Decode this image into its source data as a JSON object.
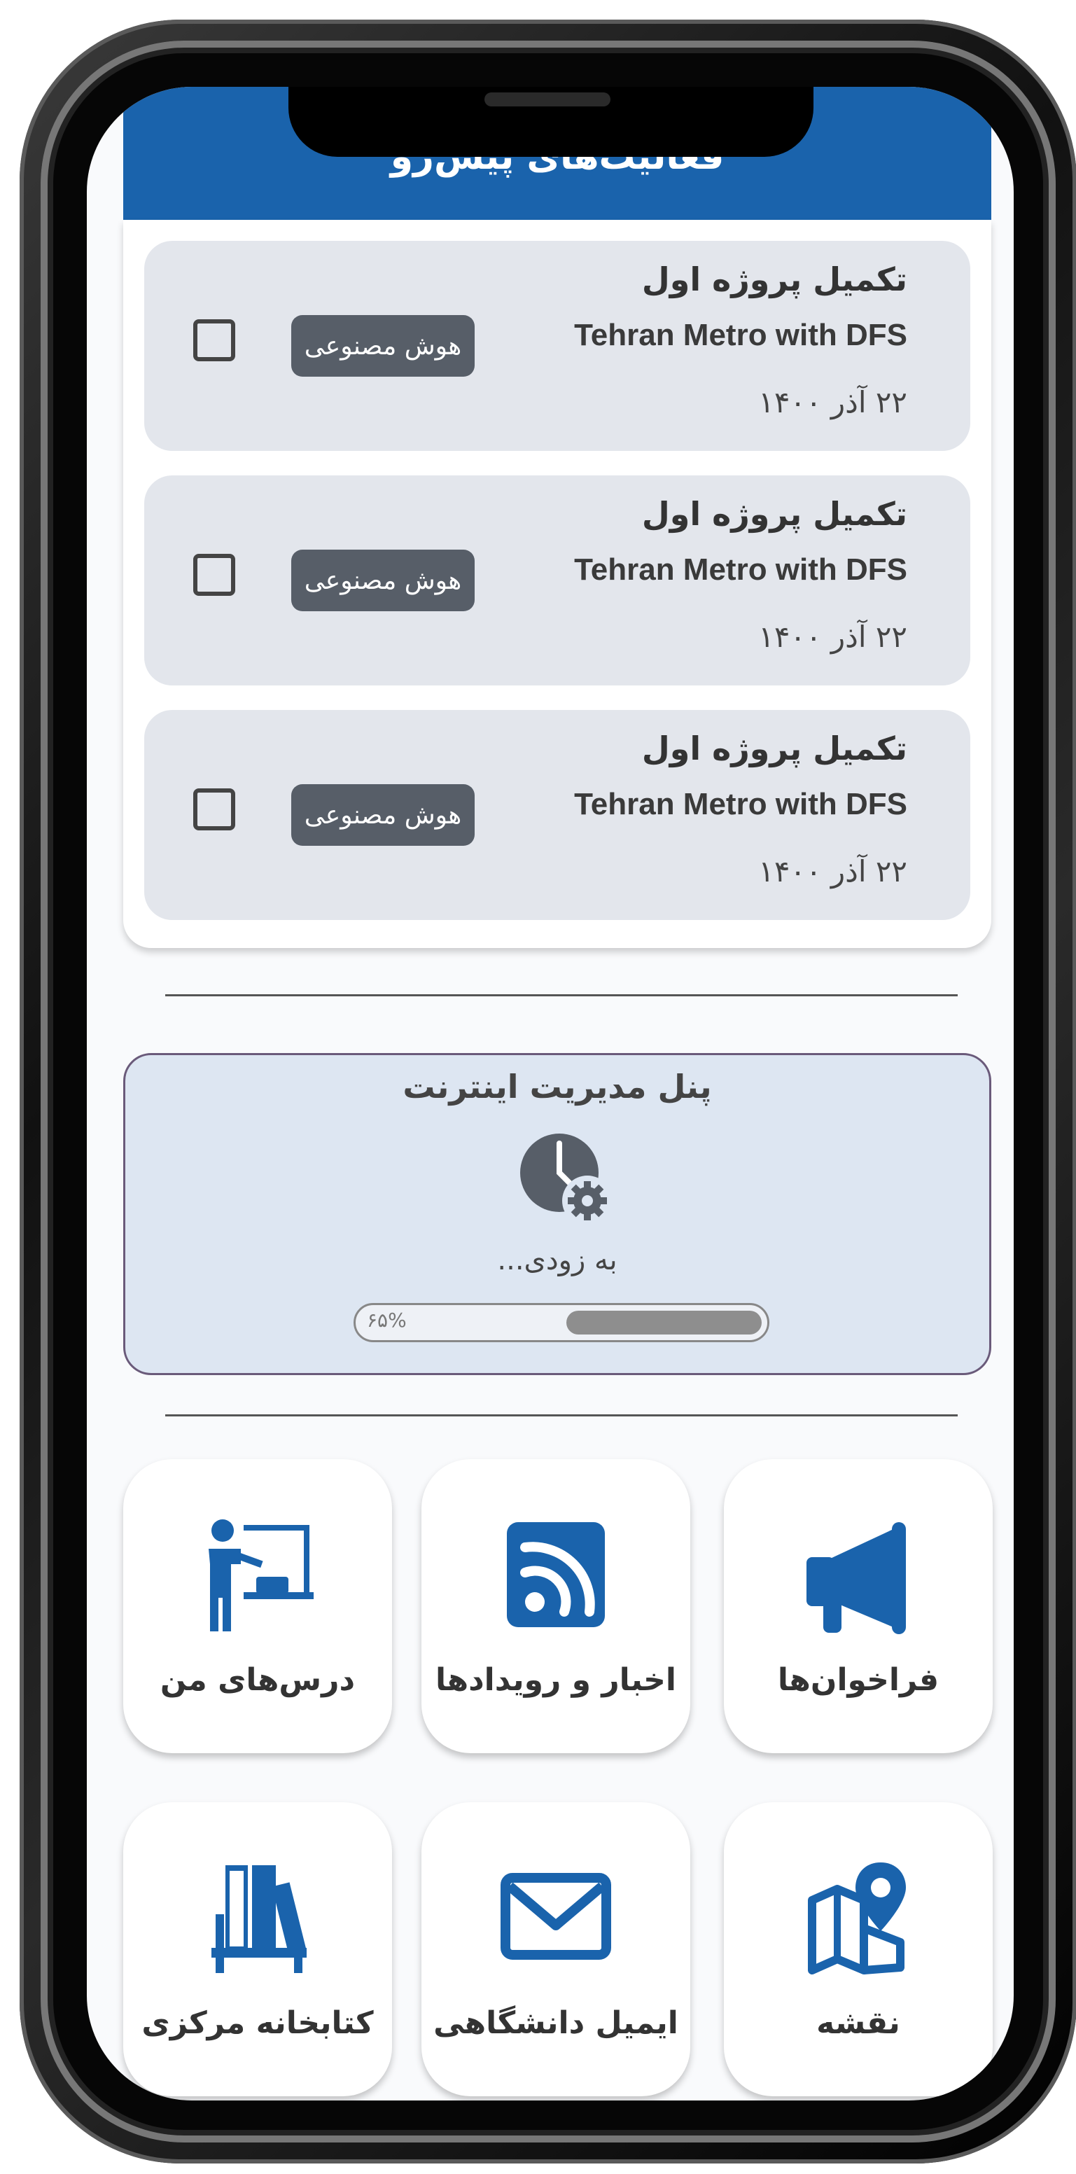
{
  "header": {
    "title": "فعالیت‌های پیش‌رو"
  },
  "tasks": [
    {
      "title": "تکمیل پروژه اول",
      "subtitle": "Tehran Metro with DFS",
      "date": "۲۲ آذر ۱۴۰۰",
      "tag": "هوش مصنوعی",
      "checked": false
    },
    {
      "title": "تکمیل پروژه اول",
      "subtitle": "Tehran Metro with DFS",
      "date": "۲۲ آذر ۱۴۰۰",
      "tag": "هوش مصنوعی",
      "checked": false
    },
    {
      "title": "تکمیل پروژه اول",
      "subtitle": "Tehran Metro with DFS",
      "date": "۲۲ آذر ۱۴۰۰",
      "tag": "هوش مصنوعی",
      "checked": false
    }
  ],
  "panel": {
    "title": "پنل مدیریت اینترنت",
    "status": "به زودی...",
    "progress_label": "۶۵%",
    "progress_value": 0.65,
    "icon": "clock-gear-icon"
  },
  "tiles": [
    {
      "label": "فراخوان‌ها",
      "icon": "megaphone-icon"
    },
    {
      "label": "اخبار و رویدادها",
      "icon": "rss-icon"
    },
    {
      "label": "درس‌های من",
      "icon": "teacher-board-icon"
    },
    {
      "label": "نقشه",
      "icon": "map-pin-icon"
    },
    {
      "label": "ایمیل دانشگاهی",
      "icon": "envelope-icon"
    },
    {
      "label": "کتابخانه مرکزی",
      "icon": "bookshelf-icon"
    }
  ],
  "colors": {
    "accent": "#1a63ac",
    "tag_bg": "#575e68",
    "task_bg": "#e3e6ec",
    "panel_bg": "#dde6f2"
  }
}
